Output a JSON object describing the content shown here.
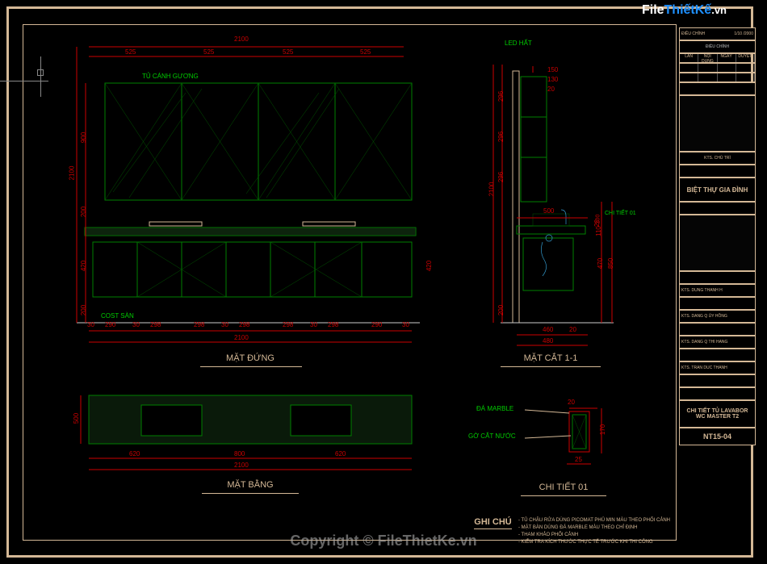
{
  "watermark": {
    "file": "File",
    "thietke": "ThiếtKế",
    "vn": ".vn"
  },
  "copyright": "Copyright © FileThietKe.vn",
  "views": {
    "elevation": "MẶT ĐỨNG",
    "plan": "MẶT BẰNG",
    "section": "MẶT CẮT 1-1",
    "detail": "CHI TIẾT 01"
  },
  "labels": {
    "mirror_cabinet": "TỦ CÁNH GƯƠNG",
    "floor_level": "COST SÀN",
    "led": "LED HẤT",
    "detail_ref": "CHI TIẾT 01",
    "marble": "ĐÁ MARBLE",
    "water_drip": "GỜ CẮT NƯỚC"
  },
  "dimensions": {
    "total_width": "2100",
    "mirror_bay": "525",
    "mirror_height": "900",
    "gap_200": "200",
    "base_420": "420",
    "cab_290": "290",
    "cab_298": "298",
    "btw_30": "30",
    "plan_620": "620",
    "plan_800": "800",
    "plan_500": "500",
    "section_460": "460",
    "section_500_w": "500",
    "section_480": "480",
    "section_850": "850",
    "section_470": "470",
    "section_110": "110",
    "section_20": "20",
    "section_150": "150",
    "section_130": "130",
    "section_296a": "296",
    "section_296b": "296",
    "section_296c": "296",
    "section_2100": "2100",
    "detail_20": "20",
    "detail_170": "170",
    "detail_25": "25"
  },
  "titleblock": {
    "project": "BIỆT THỰ GIA ĐÌNH",
    "sheet_title_1": "CHI TIẾT TỦ LAVABOR",
    "sheet_title_2": "WC MASTER T2",
    "sheet_no": "NT15-04",
    "rev_header_1": "ĐIỀU CHỈNH",
    "col_a": "LẦN",
    "col_b": "NỘI DUNG",
    "col_c": "NGÀY",
    "col_d": "DUYỆT",
    "scale": "1/10 /2000",
    "ktl": "KTS. CHỦ TRÌ",
    "tk1": "KTS. DUNG THANH H",
    "tk2": "KTS. DANG Q ỦY HỒNG",
    "tk3": "KTS. DANG Q THI HANG",
    "tk4": "KTS. TRAN DUC THANH"
  },
  "ghichu": {
    "title": "GHI CHÚ",
    "n1": "- TỦ CHẬU RỬA DÙNG PICOMAT PHỦ MIN MÀU THEO PHỐI CẢNH",
    "n2": "- MẶT BÀN DÙNG ĐÁ MARBLE MÀU THEO CHỈ ĐỊNH",
    "n3": "- THAM KHẢO PHỐI CẢNH",
    "n4": "- KIỂM TRA KÍCH THƯỚC THỰC TẾ TRƯỚC KHI THI CÔNG"
  }
}
